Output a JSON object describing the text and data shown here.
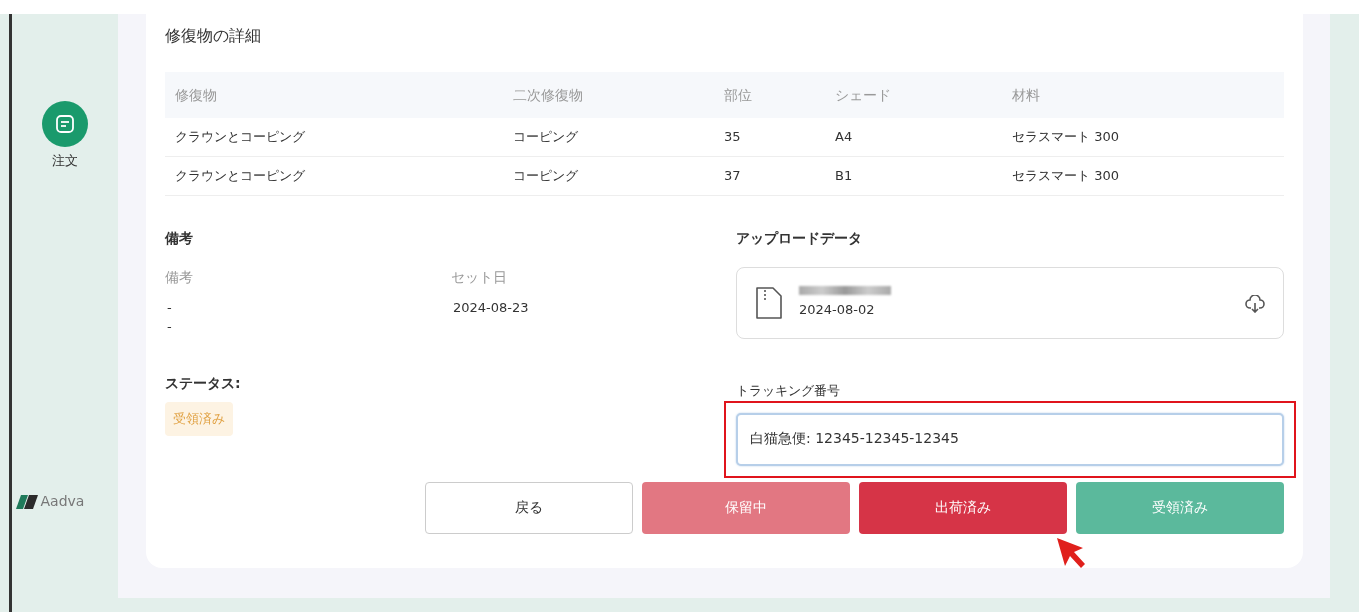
{
  "sidebar": {
    "nav_items": [
      {
        "label": "注文",
        "selected": true
      }
    ],
    "logo": "Aadva"
  },
  "restoration": {
    "title": "修復物の詳細",
    "columns": [
      "修復物",
      "二次修復物",
      "部位",
      "シェード",
      "材料"
    ],
    "rows": [
      [
        "クラウンとコーピング",
        "コーピング",
        "35",
        "A4",
        "セラスマート 300"
      ],
      [
        "クラウンとコーピング",
        "コーピング",
        "37",
        "B1",
        "セラスマート 300"
      ]
    ]
  },
  "notes": {
    "title": "備考",
    "columns": [
      {
        "label": "備考",
        "values": [
          "-",
          "-"
        ]
      },
      {
        "label": "セット日",
        "values": [
          "2024-08-23"
        ]
      }
    ]
  },
  "upload": {
    "title": "アップロードデータ",
    "files": [
      {
        "date": "2024-08-02",
        "name_blurred": true
      }
    ]
  },
  "status": {
    "label": "ステータス:",
    "badge": "受領済み"
  },
  "tracking": {
    "label": "トラッキング番号",
    "value": "白猫急便: 12345-12345-12345",
    "highlighted": true
  },
  "buttons": [
    {
      "label": "戻る",
      "kind": "outline",
      "pointed": false
    },
    {
      "label": "保留中",
      "kind": "danger-light",
      "pointed": false
    },
    {
      "label": "出荷済み",
      "kind": "danger",
      "pointed": true
    },
    {
      "label": "受領済み",
      "kind": "success",
      "pointed": false
    }
  ]
}
